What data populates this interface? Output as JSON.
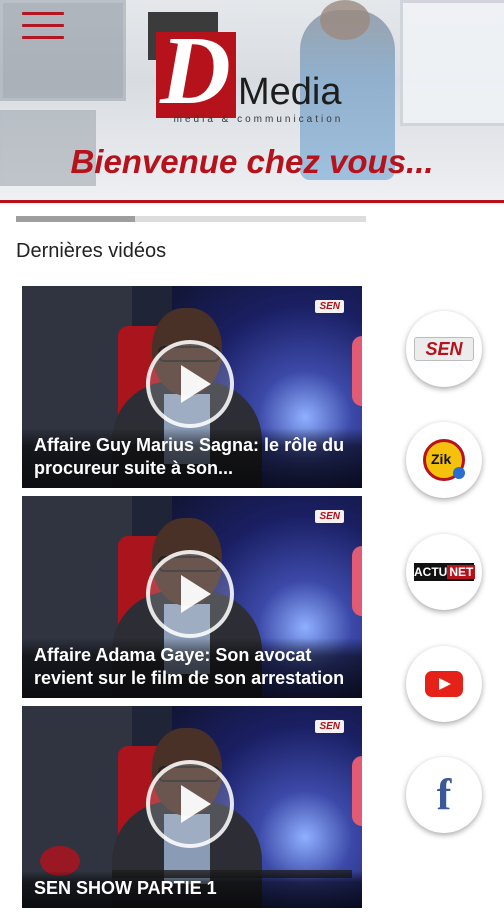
{
  "header": {
    "logo_letter": "D",
    "logo_word": "Media",
    "logo_tagline": "media & communication",
    "welcome": "Bienvenue chez vous..."
  },
  "progress": {
    "fraction": 0.34
  },
  "section_title": "Dernières vidéos",
  "videos": [
    {
      "title": "Affaire Guy Marius Sagna: le rôle du procureur suite à son...",
      "channel_badge": "SEN"
    },
    {
      "title": "Affaire Adama Gaye: Son avocat revient sur le film de son arrestation",
      "channel_badge": "SEN"
    },
    {
      "title": "SEN SHOW PARTIE 1",
      "channel_badge": "SEN"
    }
  ],
  "channels": [
    {
      "name": "sen-tv",
      "label": "SEN"
    },
    {
      "name": "zik-fm",
      "label": "Zik"
    },
    {
      "name": "actu-net",
      "label_a": "ACTU",
      "label_b": "NET"
    },
    {
      "name": "youtube",
      "icon": "play-icon"
    },
    {
      "name": "facebook",
      "label": "f"
    }
  ],
  "colors": {
    "brand_red": "#b5121b",
    "facebook_blue": "#3b5998",
    "youtube_red": "#e62117"
  }
}
